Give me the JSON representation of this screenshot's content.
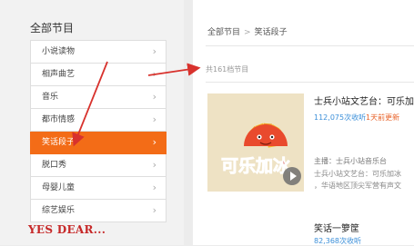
{
  "sidebar": {
    "title": "全部节目",
    "items": [
      {
        "label": "小说读物"
      },
      {
        "label": "相声曲艺"
      },
      {
        "label": "音乐"
      },
      {
        "label": "都市情感"
      },
      {
        "label": "笑话段子"
      },
      {
        "label": "脱口秀"
      },
      {
        "label": "母婴儿童"
      },
      {
        "label": "综艺娱乐"
      }
    ],
    "active_index": 4,
    "chevron": "›"
  },
  "breadcrumb": {
    "root": "全部节目",
    "separator": ">",
    "current": "笑话段子"
  },
  "count_text": "共161档节目",
  "programs": [
    {
      "title": "士兵小站文艺台：可乐加冰",
      "listens": "112,075次收听",
      "updated": "1天前更新",
      "host": "主播：士兵小站音乐台",
      "desc_line1": "士兵小站文艺台：可乐加冰",
      "desc_line2": "，华语地区顶尖军营有声文",
      "cover_text": "可乐加冰"
    },
    {
      "title": "笑话一箩筐",
      "listens": "82,368次收听",
      "cover_text": "YES DEAR..."
    }
  ],
  "colors": {
    "accent": "#f36c17",
    "link_blue": "#3b8fd9",
    "arrow_red": "#d8322d"
  },
  "icons": [
    "chevron-right-icon",
    "play-icon",
    "annotation-arrow"
  ]
}
